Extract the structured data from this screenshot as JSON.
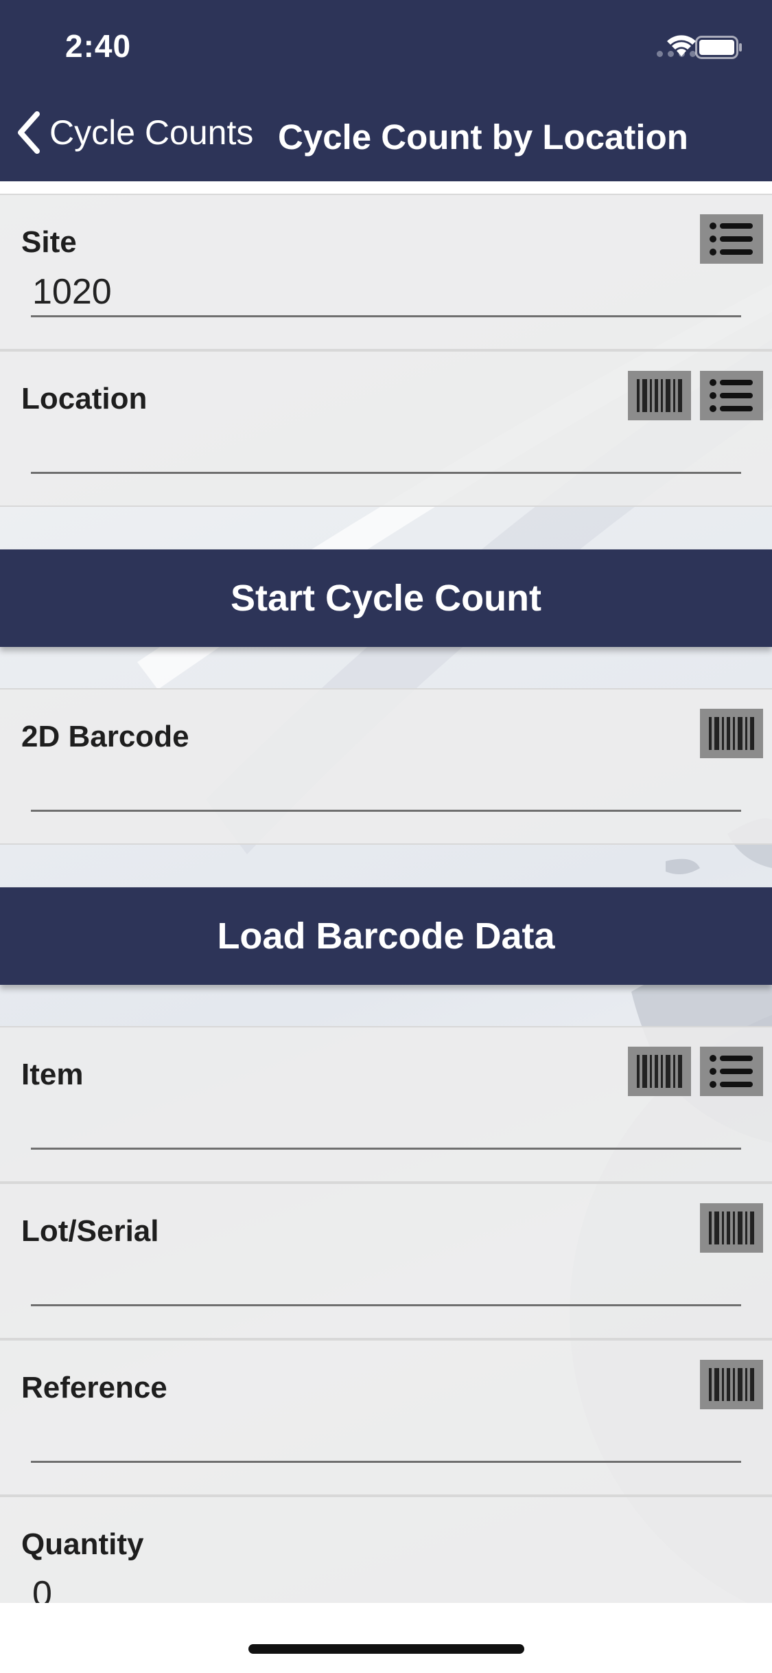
{
  "status_bar": {
    "time": "2:40"
  },
  "nav": {
    "back_label": "Cycle Counts",
    "title": "Cycle Count by Location"
  },
  "fields": {
    "site": {
      "label": "Site",
      "value": "1020"
    },
    "location": {
      "label": "Location",
      "value": ""
    },
    "barcode_2d": {
      "label": "2D Barcode",
      "value": ""
    },
    "item": {
      "label": "Item",
      "value": ""
    },
    "lot_serial": {
      "label": "Lot/Serial",
      "value": ""
    },
    "reference": {
      "label": "Reference",
      "value": ""
    },
    "quantity": {
      "label": "Quantity",
      "value": "0"
    }
  },
  "buttons": {
    "start_cycle_count": "Start Cycle Count",
    "load_barcode_data": "Load Barcode Data"
  },
  "colors": {
    "brand": "#2d3458",
    "icon_button": "#8c8c8c"
  },
  "icons": [
    "back-chevron-icon",
    "wifi-icon",
    "battery-icon",
    "list-icon",
    "barcode-icon"
  ]
}
